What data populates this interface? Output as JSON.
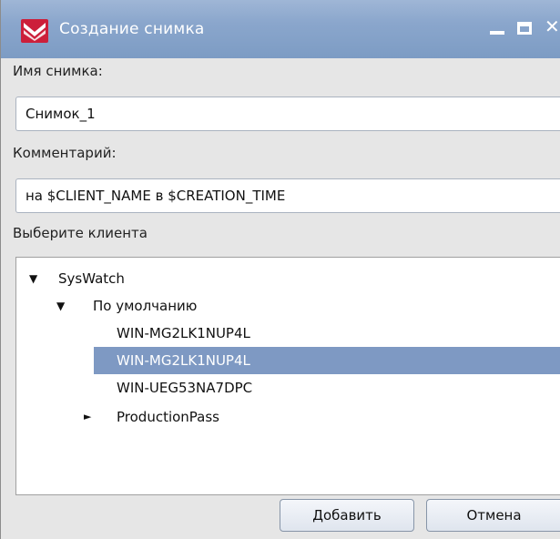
{
  "window": {
    "title": "Создание снимка",
    "controls": {
      "minimize": "_",
      "maximize": "□",
      "close": "✕"
    }
  },
  "form": {
    "name_label": "Имя снимка:",
    "name_value": "Снимок_1",
    "comment_label": "Комментарий:",
    "comment_value": "на $CLIENT_NAME в $CREATION_TIME",
    "client_label": "Выберите клиента"
  },
  "tree": {
    "nodes": [
      {
        "label": "SysWatch",
        "expander": "▼",
        "level": 0,
        "selected": false
      },
      {
        "label": "По умолчанию",
        "expander": "▼",
        "level": 1,
        "selected": false
      },
      {
        "label": "WIN-MG2LK1NUP4L",
        "expander": "",
        "level": 2,
        "selected": false
      },
      {
        "label": "WIN-MG2LK1NUP4L",
        "expander": "",
        "level": 2,
        "selected": true
      },
      {
        "label": "WIN-UEG53NA7DPC",
        "expander": "",
        "level": 2,
        "selected": false
      },
      {
        "label": "ProductionPass",
        "expander": "►",
        "level": 1,
        "selected": false
      }
    ]
  },
  "buttons": {
    "add": "Добавить",
    "cancel": "Отмена"
  },
  "colors": {
    "titlebar": "#8aa6cc",
    "selection": "#7e99c3",
    "background": "#e6e6e6"
  }
}
